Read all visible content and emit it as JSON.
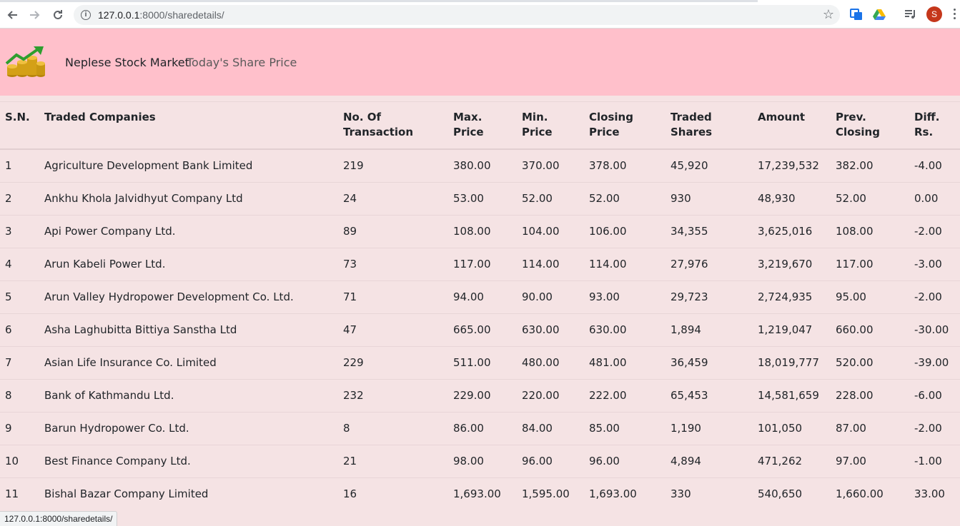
{
  "browser": {
    "url_host": "127.0.0.1",
    "url_path": ":8000/sharedetails/",
    "avatar_letter": "S",
    "status_url": "127.0.0.1:8000/sharedetails/"
  },
  "header": {
    "brand": "Neplese Stock Market",
    "nav_link": "Today's Share Price",
    "background": "#ffc0cb"
  },
  "table": {
    "columns": [
      {
        "line1": "S.N.",
        "line2": ""
      },
      {
        "line1": "Traded Companies",
        "line2": ""
      },
      {
        "line1": "No. Of",
        "line2": "Transaction"
      },
      {
        "line1": "Max.",
        "line2": "Price"
      },
      {
        "line1": "Min.",
        "line2": "Price"
      },
      {
        "line1": "Closing",
        "line2": "Price"
      },
      {
        "line1": "Traded",
        "line2": "Shares"
      },
      {
        "line1": "Amount",
        "line2": ""
      },
      {
        "line1": "Prev.",
        "line2": "Closing"
      },
      {
        "line1": "Diff.",
        "line2": "Rs."
      }
    ],
    "rows": [
      [
        "1",
        "Agriculture Development Bank Limited",
        "219",
        "380.00",
        "370.00",
        "378.00",
        "45,920",
        "17,239,532",
        "382.00",
        "-4.00"
      ],
      [
        "2",
        "Ankhu Khola Jalvidhyut Company Ltd",
        "24",
        "53.00",
        "52.00",
        "52.00",
        "930",
        "48,930",
        "52.00",
        "0.00"
      ],
      [
        "3",
        "Api Power Company Ltd.",
        "89",
        "108.00",
        "104.00",
        "106.00",
        "34,355",
        "3,625,016",
        "108.00",
        "-2.00"
      ],
      [
        "4",
        "Arun Kabeli Power Ltd.",
        "73",
        "117.00",
        "114.00",
        "114.00",
        "27,976",
        "3,219,670",
        "117.00",
        "-3.00"
      ],
      [
        "5",
        "Arun Valley Hydropower Development Co. Ltd.",
        "71",
        "94.00",
        "90.00",
        "93.00",
        "29,723",
        "2,724,935",
        "95.00",
        "-2.00"
      ],
      [
        "6",
        "Asha Laghubitta Bittiya Sanstha Ltd",
        "47",
        "665.00",
        "630.00",
        "630.00",
        "1,894",
        "1,219,047",
        "660.00",
        "-30.00"
      ],
      [
        "7",
        "Asian Life Insurance Co. Limited",
        "229",
        "511.00",
        "480.00",
        "481.00",
        "36,459",
        "18,019,777",
        "520.00",
        "-39.00"
      ],
      [
        "8",
        "Bank of Kathmandu Ltd.",
        "232",
        "229.00",
        "220.00",
        "222.00",
        "65,453",
        "14,581,659",
        "228.00",
        "-6.00"
      ],
      [
        "9",
        "Barun Hydropower Co. Ltd.",
        "8",
        "86.00",
        "84.00",
        "85.00",
        "1,190",
        "101,050",
        "87.00",
        "-2.00"
      ],
      [
        "10",
        "Best Finance Company Ltd.",
        "21",
        "98.00",
        "96.00",
        "96.00",
        "4,894",
        "471,262",
        "97.00",
        "-1.00"
      ],
      [
        "11",
        "Bishal Bazar Company Limited",
        "16",
        "1,693.00",
        "1,595.00",
        "1,693.00",
        "330",
        "540,650",
        "1,660.00",
        "33.00"
      ]
    ]
  }
}
